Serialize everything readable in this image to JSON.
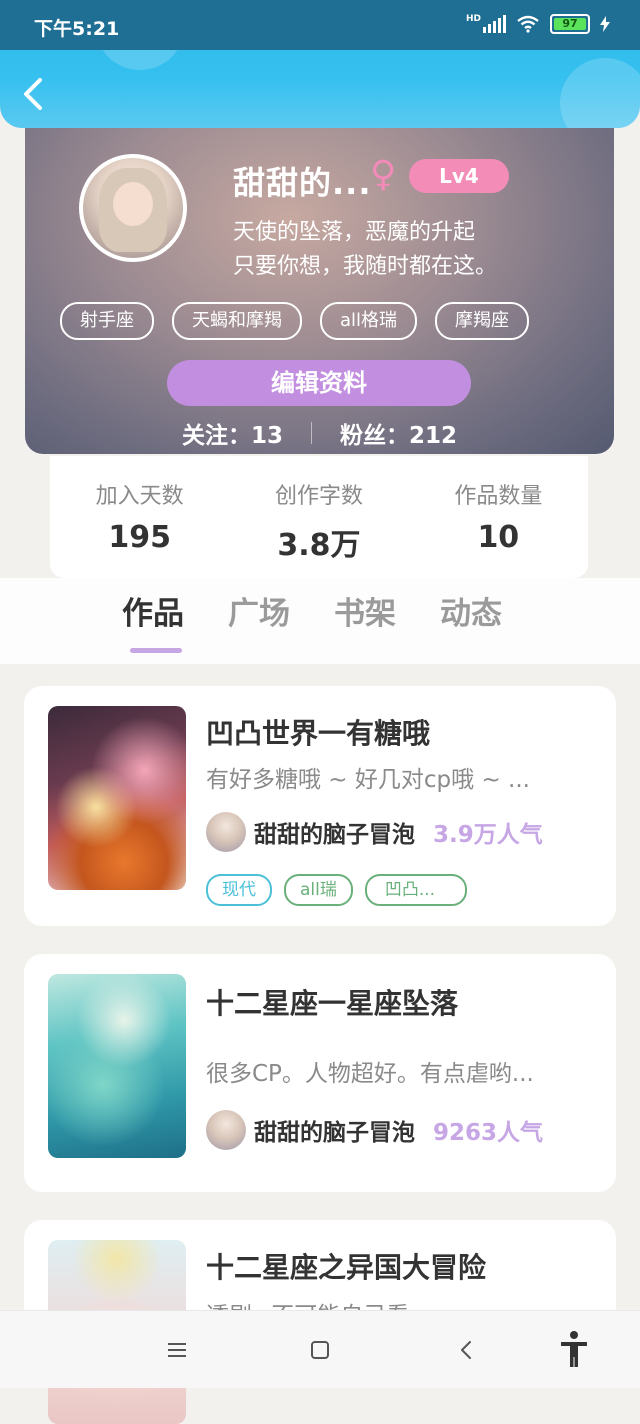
{
  "status_bar": {
    "time": "下午5:21",
    "battery": "97",
    "network": "HD"
  },
  "header": {
    "back_icon": "back-arrow-icon"
  },
  "profile": {
    "nickname": "甜甜的...",
    "gender_symbol": "♀",
    "level": "Lv4",
    "bio_line1": "天使的坠落，恶魔的升起",
    "bio_line2": "只要你想，我随时都在这。",
    "tags": [
      "射手座",
      "天蝎和摩羯",
      "all格瑞",
      "摩羯座"
    ],
    "edit_button": "编辑资料",
    "following": "关注：13",
    "followers": "粉丝：212"
  },
  "stats": [
    {
      "label": "加入天数",
      "value": "195"
    },
    {
      "label": "创作字数",
      "value": "3.8万"
    },
    {
      "label": "作品数量",
      "value": "10"
    }
  ],
  "tabs": [
    "作品",
    "广场",
    "书架",
    "动态"
  ],
  "works": [
    {
      "title": "凹凸世界一有糖哦",
      "desc": "有好多糖哦 ~ 好几对cp哦 ~ ...",
      "author": "甜甜的脑子冒泡",
      "popularity": "3.9万人气",
      "tags": [
        {
          "text": "现代",
          "color": "#4cc0d8"
        },
        {
          "text": "all瑞",
          "color": "#6ab07a"
        },
        {
          "text": "凹凸...",
          "color": "#6ab07a"
        }
      ]
    },
    {
      "title": "十二星座一星座坠落",
      "desc": "很多CP。人物超好。有点虐哟...",
      "author": "甜甜的脑子冒泡",
      "popularity": "9263人气",
      "tags": []
    },
    {
      "title": "十二星座之异国大冒险",
      "desc": "透剧~不可能自己看",
      "author": "",
      "popularity": "",
      "tags": []
    }
  ],
  "colors": {
    "accent_purple": "#c28ee0",
    "header_blue": "#35c0ef",
    "level_pink": "#f48cb8"
  }
}
